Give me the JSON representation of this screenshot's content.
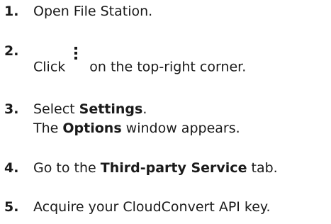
{
  "steps": [
    {
      "number": "1.",
      "text": "Open File Station."
    },
    {
      "number": "2.",
      "text_before": "Click",
      "icon": "kebab-menu-icon",
      "text_after": "on the top-right corner."
    },
    {
      "number": "3.",
      "text_before": "Select ",
      "bold": "Settings",
      "text_after": ".",
      "line2_before": "The ",
      "line2_bold": "Options",
      "line2_after": " window appears."
    },
    {
      "number": "4.",
      "text_before": "Go to the ",
      "bold": "Third-party Service",
      "text_after": " tab."
    },
    {
      "number": "5.",
      "text": "Acquire your CloudConvert API key."
    }
  ]
}
